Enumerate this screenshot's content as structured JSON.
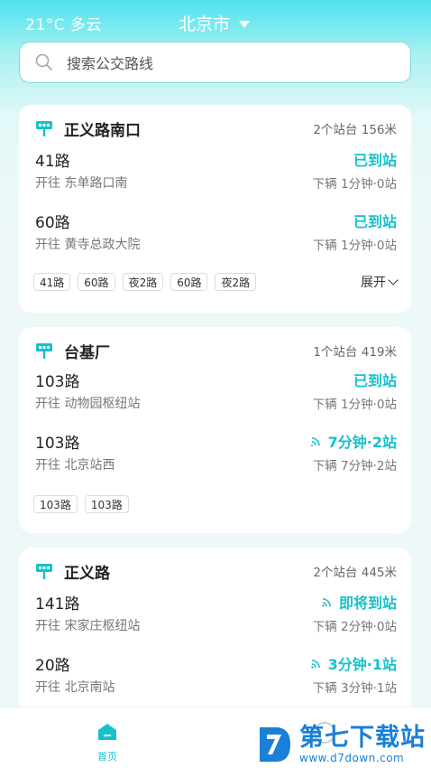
{
  "status": {
    "weather": "21°C 多云",
    "city": "北京市"
  },
  "search": {
    "placeholder": "搜索公交路线"
  },
  "colors": {
    "accent": "#16c1cc",
    "header_gradient_top": "#4ee3ee",
    "watermark_blue": "#1a7fd6"
  },
  "stops": [
    {
      "name": "正义路南口",
      "meta": "2个站台 156米",
      "routes": [
        {
          "name": "41路",
          "dest": "开往 东单路口南",
          "status": "已到站",
          "signal": false,
          "next": "下辆 1分钟·0站"
        },
        {
          "name": "60路",
          "dest": "开往 黄寺总政大院",
          "status": "已到站",
          "signal": false,
          "next": "下辆 1分钟·0站"
        }
      ],
      "chips": [
        "41路",
        "60路",
        "夜2路",
        "60路",
        "夜2路"
      ],
      "expand": "展开"
    },
    {
      "name": "台基厂",
      "meta": "1个站台 419米",
      "routes": [
        {
          "name": "103路",
          "dest": "开往 动物园枢纽站",
          "status": "已到站",
          "signal": false,
          "next": "下辆 1分钟·0站"
        },
        {
          "name": "103路",
          "dest": "开往 北京站西",
          "status": "7分钟·2站",
          "signal": true,
          "next": "下辆 7分钟·2站"
        }
      ],
      "chips": [
        "103路",
        "103路"
      ]
    },
    {
      "name": "正义路",
      "meta": "2个站台 445米",
      "routes": [
        {
          "name": "141路",
          "dest": "开往 宋家庄枢纽站",
          "status": "即将到站",
          "signal": true,
          "next": "下辆 2分钟·0站"
        },
        {
          "name": "20路",
          "dest": "开往 北京南站",
          "status": "3分钟·1站",
          "signal": true,
          "next": "下辆 3分钟·1站"
        }
      ]
    }
  ],
  "tabbar": {
    "home_label": "首页",
    "home_icon": "home-icon",
    "mine_icon": "profile-icon"
  },
  "watermark": {
    "title": "第七下载站",
    "url": "www.d7down.com"
  }
}
